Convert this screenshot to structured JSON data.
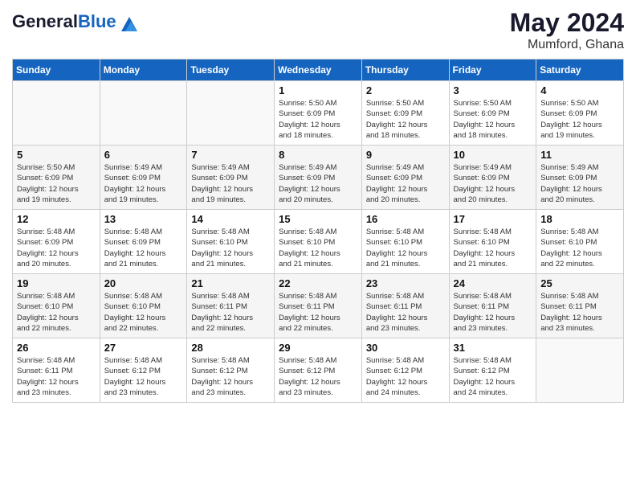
{
  "header": {
    "logo_general": "General",
    "logo_blue": "Blue",
    "month_year": "May 2024",
    "location": "Mumford, Ghana"
  },
  "days_of_week": [
    "Sunday",
    "Monday",
    "Tuesday",
    "Wednesday",
    "Thursday",
    "Friday",
    "Saturday"
  ],
  "weeks": [
    [
      {
        "day": "",
        "info": ""
      },
      {
        "day": "",
        "info": ""
      },
      {
        "day": "",
        "info": ""
      },
      {
        "day": "1",
        "info": "Sunrise: 5:50 AM\nSunset: 6:09 PM\nDaylight: 12 hours\nand 18 minutes."
      },
      {
        "day": "2",
        "info": "Sunrise: 5:50 AM\nSunset: 6:09 PM\nDaylight: 12 hours\nand 18 minutes."
      },
      {
        "day": "3",
        "info": "Sunrise: 5:50 AM\nSunset: 6:09 PM\nDaylight: 12 hours\nand 18 minutes."
      },
      {
        "day": "4",
        "info": "Sunrise: 5:50 AM\nSunset: 6:09 PM\nDaylight: 12 hours\nand 19 minutes."
      }
    ],
    [
      {
        "day": "5",
        "info": "Sunrise: 5:50 AM\nSunset: 6:09 PM\nDaylight: 12 hours\nand 19 minutes."
      },
      {
        "day": "6",
        "info": "Sunrise: 5:49 AM\nSunset: 6:09 PM\nDaylight: 12 hours\nand 19 minutes."
      },
      {
        "day": "7",
        "info": "Sunrise: 5:49 AM\nSunset: 6:09 PM\nDaylight: 12 hours\nand 19 minutes."
      },
      {
        "day": "8",
        "info": "Sunrise: 5:49 AM\nSunset: 6:09 PM\nDaylight: 12 hours\nand 20 minutes."
      },
      {
        "day": "9",
        "info": "Sunrise: 5:49 AM\nSunset: 6:09 PM\nDaylight: 12 hours\nand 20 minutes."
      },
      {
        "day": "10",
        "info": "Sunrise: 5:49 AM\nSunset: 6:09 PM\nDaylight: 12 hours\nand 20 minutes."
      },
      {
        "day": "11",
        "info": "Sunrise: 5:49 AM\nSunset: 6:09 PM\nDaylight: 12 hours\nand 20 minutes."
      }
    ],
    [
      {
        "day": "12",
        "info": "Sunrise: 5:48 AM\nSunset: 6:09 PM\nDaylight: 12 hours\nand 20 minutes."
      },
      {
        "day": "13",
        "info": "Sunrise: 5:48 AM\nSunset: 6:09 PM\nDaylight: 12 hours\nand 21 minutes."
      },
      {
        "day": "14",
        "info": "Sunrise: 5:48 AM\nSunset: 6:10 PM\nDaylight: 12 hours\nand 21 minutes."
      },
      {
        "day": "15",
        "info": "Sunrise: 5:48 AM\nSunset: 6:10 PM\nDaylight: 12 hours\nand 21 minutes."
      },
      {
        "day": "16",
        "info": "Sunrise: 5:48 AM\nSunset: 6:10 PM\nDaylight: 12 hours\nand 21 minutes."
      },
      {
        "day": "17",
        "info": "Sunrise: 5:48 AM\nSunset: 6:10 PM\nDaylight: 12 hours\nand 21 minutes."
      },
      {
        "day": "18",
        "info": "Sunrise: 5:48 AM\nSunset: 6:10 PM\nDaylight: 12 hours\nand 22 minutes."
      }
    ],
    [
      {
        "day": "19",
        "info": "Sunrise: 5:48 AM\nSunset: 6:10 PM\nDaylight: 12 hours\nand 22 minutes."
      },
      {
        "day": "20",
        "info": "Sunrise: 5:48 AM\nSunset: 6:10 PM\nDaylight: 12 hours\nand 22 minutes."
      },
      {
        "day": "21",
        "info": "Sunrise: 5:48 AM\nSunset: 6:11 PM\nDaylight: 12 hours\nand 22 minutes."
      },
      {
        "day": "22",
        "info": "Sunrise: 5:48 AM\nSunset: 6:11 PM\nDaylight: 12 hours\nand 22 minutes."
      },
      {
        "day": "23",
        "info": "Sunrise: 5:48 AM\nSunset: 6:11 PM\nDaylight: 12 hours\nand 23 minutes."
      },
      {
        "day": "24",
        "info": "Sunrise: 5:48 AM\nSunset: 6:11 PM\nDaylight: 12 hours\nand 23 minutes."
      },
      {
        "day": "25",
        "info": "Sunrise: 5:48 AM\nSunset: 6:11 PM\nDaylight: 12 hours\nand 23 minutes."
      }
    ],
    [
      {
        "day": "26",
        "info": "Sunrise: 5:48 AM\nSunset: 6:11 PM\nDaylight: 12 hours\nand 23 minutes."
      },
      {
        "day": "27",
        "info": "Sunrise: 5:48 AM\nSunset: 6:12 PM\nDaylight: 12 hours\nand 23 minutes."
      },
      {
        "day": "28",
        "info": "Sunrise: 5:48 AM\nSunset: 6:12 PM\nDaylight: 12 hours\nand 23 minutes."
      },
      {
        "day": "29",
        "info": "Sunrise: 5:48 AM\nSunset: 6:12 PM\nDaylight: 12 hours\nand 23 minutes."
      },
      {
        "day": "30",
        "info": "Sunrise: 5:48 AM\nSunset: 6:12 PM\nDaylight: 12 hours\nand 24 minutes."
      },
      {
        "day": "31",
        "info": "Sunrise: 5:48 AM\nSunset: 6:12 PM\nDaylight: 12 hours\nand 24 minutes."
      },
      {
        "day": "",
        "info": ""
      }
    ]
  ]
}
